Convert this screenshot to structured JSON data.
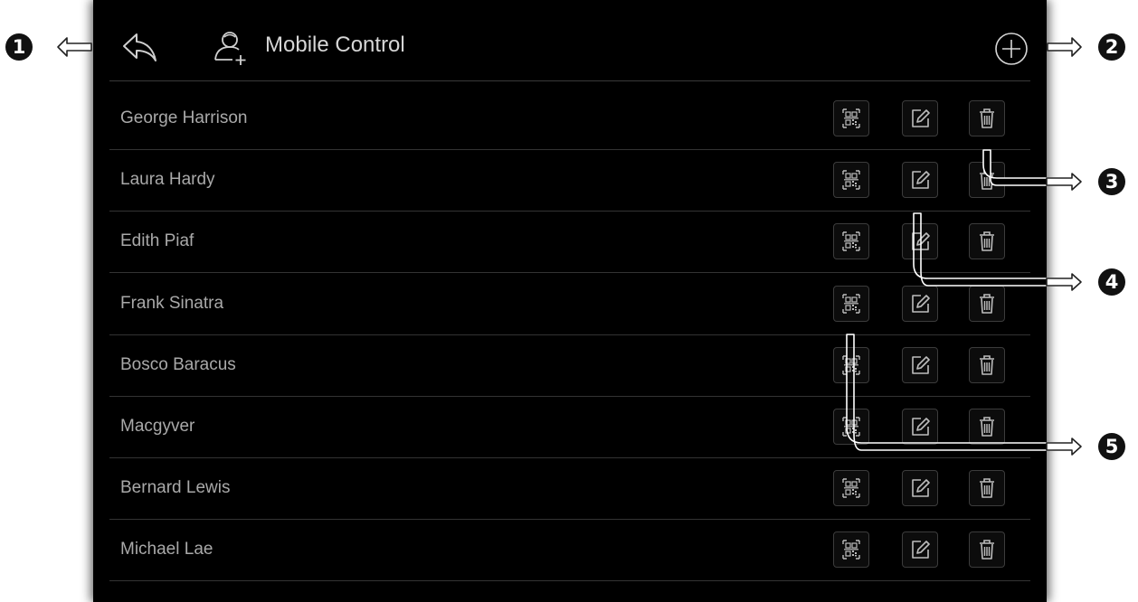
{
  "header": {
    "title": "Mobile Control",
    "back_icon": "back-arrow-icon",
    "title_icon": "user-add-icon",
    "add_icon": "plus-circle-icon"
  },
  "rows": [
    {
      "name": "George Harrison"
    },
    {
      "name": "Laura Hardy"
    },
    {
      "name": "Edith Piaf"
    },
    {
      "name": "Frank Sinatra"
    },
    {
      "name": "Bosco Baracus"
    },
    {
      "name": "Macgyver"
    },
    {
      "name": "Bernard Lewis"
    },
    {
      "name": "Michael Lae"
    }
  ],
  "row_actions": [
    "qr-code-icon",
    "edit-icon",
    "trash-icon"
  ],
  "callouts": [
    "1",
    "2",
    "3",
    "4",
    "5"
  ],
  "colors": {
    "panel_background": "#000000",
    "text": "#a9a9a9",
    "title": "#d6d6d6",
    "divider": "#333333",
    "icon_stroke": "#bdbdbd"
  }
}
